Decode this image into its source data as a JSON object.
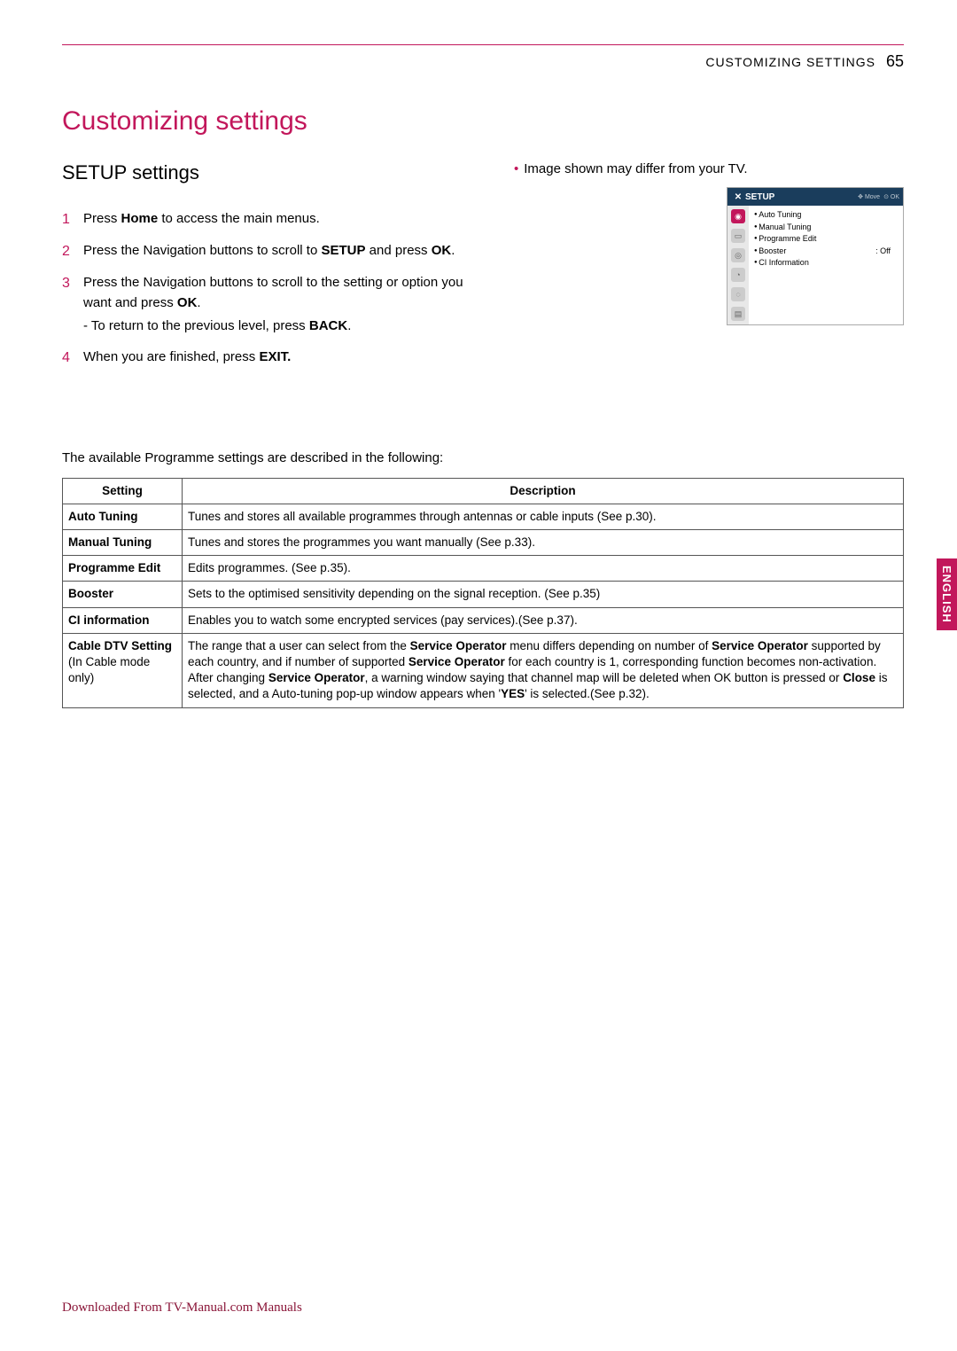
{
  "header": {
    "label": "CUSTOMIZING SETTINGS",
    "page": "65"
  },
  "main_title": "Customizing settings",
  "section_title": "SETUP settings",
  "note_text": "Image shown may differ from your TV.",
  "steps": {
    "s1_a": "Press ",
    "s1_b": "Home",
    "s1_c": " to access the main menus.",
    "s2_a": "Press the Navigation buttons to scroll to ",
    "s2_b": "SETUP",
    "s2_c": " and press ",
    "s2_d": "OK",
    "s2_e": ".",
    "s3_a": "Press the Navigation buttons to scroll to the setting or option you want and press ",
    "s3_b": "OK",
    "s3_c": ".",
    "s3_sub_a": "- To return to the previous level, press ",
    "s3_sub_b": "BACK",
    "s3_sub_c": ".",
    "s4_a": "When you are finished, press ",
    "s4_b": "EXIT."
  },
  "tv": {
    "title": "SETUP",
    "hint1": "Move",
    "hint2": "OK",
    "items": [
      {
        "label": "Auto Tuning",
        "value": ""
      },
      {
        "label": "Manual Tuning",
        "value": ""
      },
      {
        "label": "Programme Edit",
        "value": ""
      },
      {
        "label": "Booster",
        "value": ": Off"
      },
      {
        "label": "CI Information",
        "value": ""
      }
    ]
  },
  "table_intro": "The available Programme settings are described in the following:",
  "table": {
    "head_setting": "Setting",
    "head_desc": "Description",
    "rows": [
      {
        "setting": "Auto Tuning",
        "desc_plain": "Tunes and stores all available programmes through antennas or cable inputs (See p.30)."
      },
      {
        "setting": "Manual Tuning",
        "desc_plain": "Tunes and stores the programmes you want manually (See p.33)."
      },
      {
        "setting": "Programme Edit",
        "desc_plain": "Edits programmes. (See p.35)."
      },
      {
        "setting": "Booster",
        "desc_plain": "Sets to the optimised sensitivity depending on the signal reception. (See p.35)"
      },
      {
        "setting": "CI information",
        "desc_plain": "Enables you to watch some encrypted services (pay services).(See p.37)."
      }
    ],
    "row6": {
      "setting_l1": "Cable DTV Setting",
      "setting_l2": "(In Cable mode only)",
      "d1": "The range that a user can select from the ",
      "d2": "Service Operator",
      "d3": " menu differs depending on number of ",
      "d4": "Service Operator",
      "d5": " supported by each country, and if number of supported ",
      "d6": "Service Operator",
      "d7": " for each country is 1, corresponding function becomes non-activation.",
      "d8": "After changing ",
      "d9": "Service Operator",
      "d10": ", a warning window saying that channel map will be deleted when OK button is pressed or ",
      "d11": "Close",
      "d12": " is selected, and a Auto-tuning pop-up window appears when '",
      "d13": "YES",
      "d14": "' is selected.(See p.32)."
    }
  },
  "side_tab": "ENGLISH",
  "footer": "Downloaded From TV-Manual.com Manuals"
}
